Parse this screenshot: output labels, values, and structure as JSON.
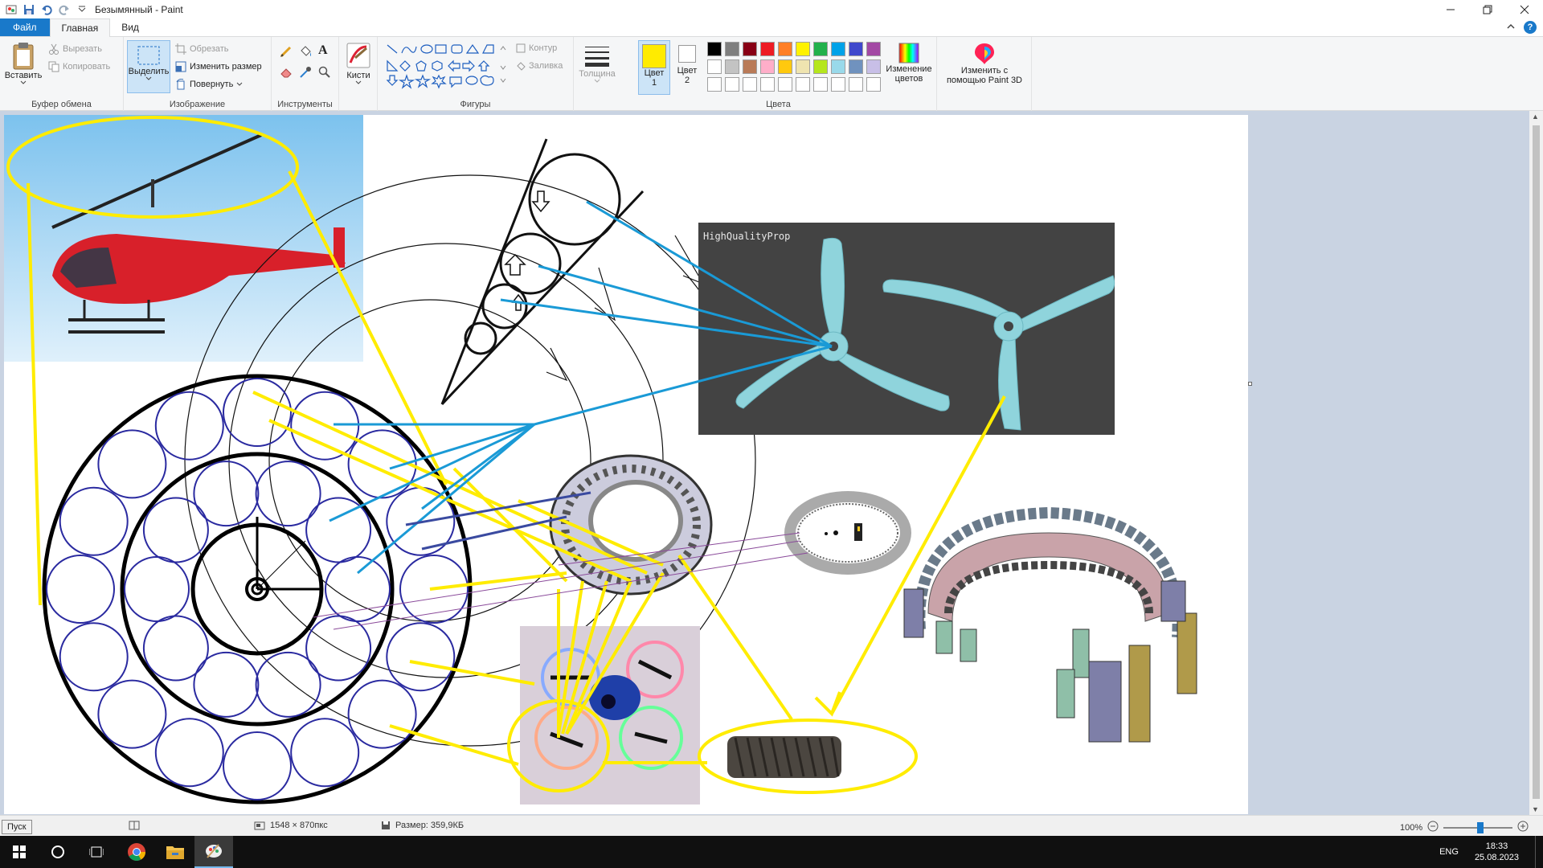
{
  "window": {
    "title": "Безымянный - Paint"
  },
  "tabs": [
    {
      "label": "Файл"
    },
    {
      "label": "Главная"
    },
    {
      "label": "Вид"
    }
  ],
  "ribbon": {
    "clipboard": {
      "group_label": "Буфер обмена",
      "paste": "Вставить",
      "cut": "Вырезать",
      "copy": "Копировать"
    },
    "image": {
      "group_label": "Изображение",
      "select": "Выделить",
      "crop": "Обрезать",
      "resize": "Изменить размер",
      "rotate": "Повернуть"
    },
    "tools": {
      "group_label": "Инструменты"
    },
    "brushes": {
      "label": "Кисти"
    },
    "shapes": {
      "group_label": "Фигуры",
      "outline": "Контур",
      "fill": "Заливка"
    },
    "size": {
      "label": "Толщина"
    },
    "color1": {
      "label_line1": "Цвет",
      "label_line2": "1",
      "color": "#ffeb00"
    },
    "color2": {
      "label_line1": "Цвет",
      "label_line2": "2",
      "color": "#ffffff"
    },
    "colors": {
      "group_label": "Цвета",
      "palette_row1": [
        "#000000",
        "#7f7f7f",
        "#880015",
        "#ed1c24",
        "#ff7f27",
        "#fff200",
        "#22b14c",
        "#00a2e8",
        "#3f48cc",
        "#a349a4"
      ],
      "palette_row2": [
        "#ffffff",
        "#c3c3c3",
        "#b97a57",
        "#ffaec9",
        "#ffc90e",
        "#efe4b0",
        "#b5e61d",
        "#99d9ea",
        "#7092be",
        "#c8bfe7"
      ],
      "palette_row3": [
        "#ffffff",
        "#ffffff",
        "#ffffff",
        "#ffffff",
        "#ffffff",
        "#ffffff",
        "#ffffff",
        "#ffffff",
        "#ffffff",
        "#ffffff"
      ],
      "edit_line1": "Изменение",
      "edit_line2": "цветов"
    },
    "paint3d": {
      "line1": "Изменить с",
      "line2": "помощью Paint 3D"
    }
  },
  "canvas": {
    "propeller_photo_text": "HighQualityProp"
  },
  "statusbar": {
    "dimensions": "1548 × 870пкс",
    "size": "Размер: 359,9КБ",
    "zoom": "100%"
  },
  "taskbar": {
    "start_tooltip": "Пуск",
    "language": "ENG",
    "time": "18:33",
    "date": "25.08.2023"
  }
}
